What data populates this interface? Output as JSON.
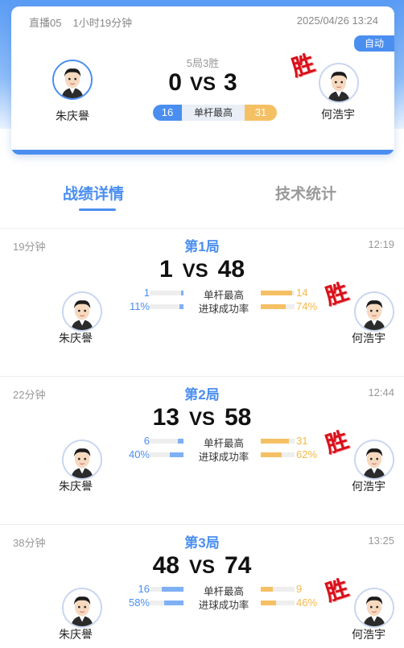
{
  "header": {
    "room": "直播05",
    "duration": "1小时19分钟",
    "datetime": "2025/04/26 13:24",
    "mode_tag": "自动",
    "format": "5局3胜",
    "score_left": "0",
    "vs": "VS",
    "score_right": "3",
    "highest_break_label": "单杆最高",
    "highest_break_left": "16",
    "highest_break_right": "31",
    "win_mark": "胜"
  },
  "players": {
    "left": "朱庆譽",
    "right": "何浩宇"
  },
  "tabs": {
    "active": "战绩详情",
    "inactive": "技术统计"
  },
  "games": [
    {
      "title": "第1局",
      "duration": "19分钟",
      "time": "12:19",
      "left_score": "1",
      "vs": "VS",
      "right_score": "48",
      "stats": [
        {
          "label": "单杆最高",
          "left": "1",
          "right": "14",
          "left_frac": 0.07,
          "right_frac": 0.93
        },
        {
          "label": "进球成功率",
          "left": "11%",
          "right": "74%",
          "left_frac": 0.11,
          "right_frac": 0.74
        }
      ],
      "winner_mark": "胜",
      "winner": "right"
    },
    {
      "title": "第2局",
      "duration": "22分钟",
      "time": "12:44",
      "left_score": "13",
      "vs": "VS",
      "right_score": "58",
      "stats": [
        {
          "label": "单杆最高",
          "left": "6",
          "right": "31",
          "left_frac": 0.16,
          "right_frac": 0.84
        },
        {
          "label": "进球成功率",
          "left": "40%",
          "right": "62%",
          "left_frac": 0.4,
          "right_frac": 0.62
        }
      ],
      "winner_mark": "胜",
      "winner": "right"
    },
    {
      "title": "第3局",
      "duration": "38分钟",
      "time": "13:25",
      "left_score": "48",
      "vs": "VS",
      "right_score": "74",
      "stats": [
        {
          "label": "单杆最高",
          "left": "16",
          "right": "9",
          "left_frac": 0.64,
          "right_frac": 0.36
        },
        {
          "label": "进球成功率",
          "left": "58%",
          "right": "46%",
          "left_frac": 0.58,
          "right_frac": 0.46
        }
      ],
      "winner_mark": "胜",
      "winner": "right"
    }
  ],
  "colors": {
    "accent": "#4a8ef0",
    "secondary": "#f5c064",
    "win_red": "#d8101a"
  },
  "icons": {
    "avatar": "player-avatar-icon"
  }
}
